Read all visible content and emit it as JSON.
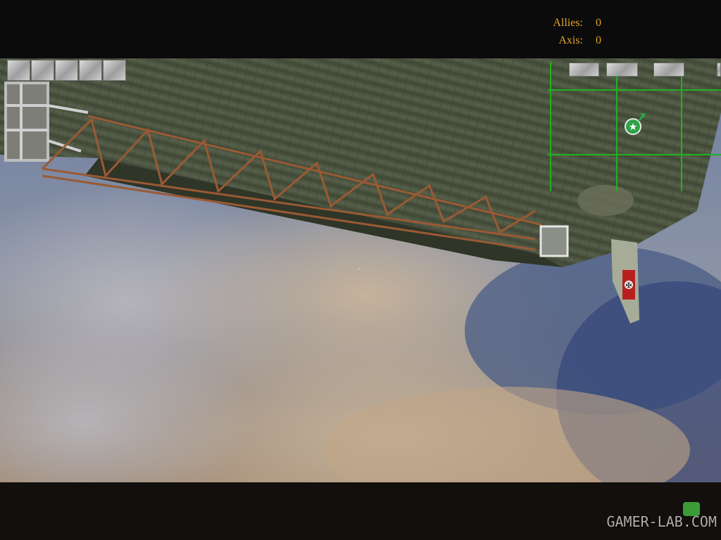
{
  "hud": {
    "score": {
      "allies_label": "Allies:",
      "allies_value": "0",
      "axis_label": "Axis:",
      "axis_value": "0"
    },
    "player_slots_count": 5,
    "minimap_slots_count": 3,
    "minimap_player_icon": "star-marker-icon",
    "crosshair_icon": "crosshair-icon"
  },
  "watermark": {
    "text": "GAMER-LAB.COM"
  },
  "colors": {
    "score_text": "#e3a42c",
    "minimap_grid": "#22b022",
    "player_marker": "#2fa14a",
    "zeppelin_hull": "#4e5642",
    "girder": "#8a4a2a",
    "sky": "#5d6f92"
  }
}
